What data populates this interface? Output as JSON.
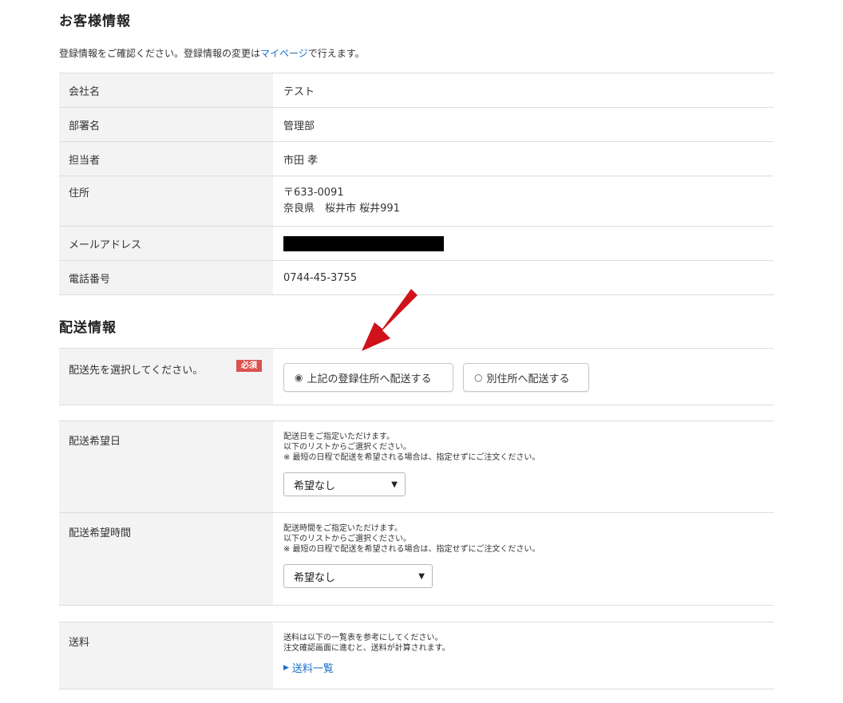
{
  "customer": {
    "title": "お客様情報",
    "note_before": "登録情報をご確認ください。登録情報の変更は",
    "note_link": "マイページ",
    "note_after": "で行えます。",
    "rows": [
      {
        "label": "会社名",
        "value": "テスト"
      },
      {
        "label": "部署名",
        "value": "管理部"
      },
      {
        "label": "担当者",
        "value": "市田 孝"
      },
      {
        "label": "住所",
        "postal": "〒633-0091",
        "address": "奈良県　桜井市 桜井991"
      },
      {
        "label": "メールアドレス",
        "value": ""
      },
      {
        "label": "電話番号",
        "value": "0744-45-3755"
      }
    ]
  },
  "shipping": {
    "title": "配送情報",
    "select_label": "配送先を選択してください。",
    "required_badge": "必須",
    "option_registered": "上記の登録住所へ配送する",
    "option_other": "別住所へ配送する",
    "selected_option": "上記の登録住所へ配送する",
    "date": {
      "label": "配送希望日",
      "line1": "配送日をご指定いただけます。",
      "line2": "以下のリストからご選択ください。",
      "line3": "※ 最短の日程で配送を希望される場合は、指定せずにご注文ください。",
      "selected": "希望なし"
    },
    "time": {
      "label": "配送希望時間",
      "line1": "配送時間をご指定いただけます。",
      "line2": "以下のリストからご選択ください。",
      "line3": "※ 最短の日程で配送を希望される場合は、指定せずにご注文ください。",
      "selected": "希望なし"
    },
    "fee": {
      "label": "送料",
      "line1": "送料は以下の一覧表を参考にしてください。",
      "line2": "注文確認画面に進むと、送料が計算されます。",
      "link": "送料一覧"
    }
  },
  "colors": {
    "link": "#1a6fc7",
    "required_badge": "#d9534f",
    "annotation_arrow": "#d0121b",
    "header_cell_bg": "#f3f3f3"
  }
}
